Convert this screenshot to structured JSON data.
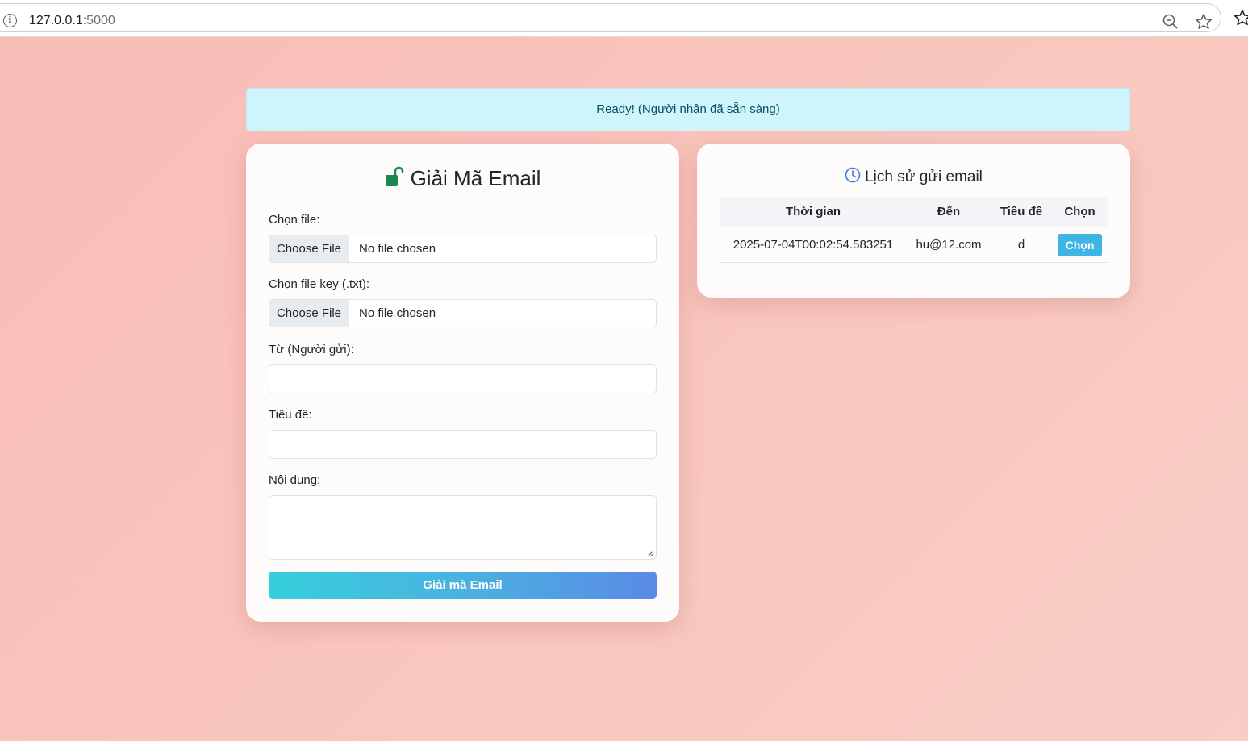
{
  "browser": {
    "url_host": "127.0.0.1",
    "url_port": ":5000"
  },
  "alert": {
    "message": "Ready! (Người nhận đã sẵn sàng)"
  },
  "decode_form": {
    "title": "Giải Mã Email",
    "title_icon": "unlock-icon",
    "file_label": "Chọn file:",
    "file_button": "Choose File",
    "file_status": "No file chosen",
    "key_label": "Chọn file key (.txt):",
    "key_button": "Choose File",
    "key_status": "No file chosen",
    "from_label": "Từ (Người gửi):",
    "from_value": "",
    "subject_label": "Tiêu đề:",
    "subject_value": "",
    "content_label": "Nội dung:",
    "content_value": "",
    "submit_label": "Giải mã Email"
  },
  "history": {
    "title": "Lịch sử gửi email",
    "title_icon": "clock-icon",
    "columns": [
      "Thời gian",
      "Đến",
      "Tiêu đề",
      "Chọn"
    ],
    "rows": [
      {
        "time": "2025-07-04T00:02:54.583251",
        "to": "hu@12.com",
        "subject": "d",
        "action": "Chọn"
      }
    ]
  },
  "colors": {
    "accent_green": "#198754",
    "accent_blue": "#3fb5e4",
    "alert_bg": "#cff4fc"
  }
}
